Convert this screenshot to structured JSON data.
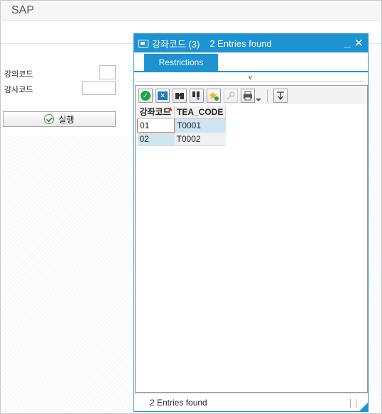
{
  "app": {
    "title": "SAP"
  },
  "form": {
    "fields": [
      {
        "label": "강의코드",
        "value": ""
      },
      {
        "label": "강사코드",
        "value": ""
      }
    ],
    "execute_label": "실행"
  },
  "dialog": {
    "title": "강좌코드 (3)",
    "entries_found": "2 Entries found",
    "minimize_glyph": "_",
    "close_glyph": "✕",
    "tab_label": "Restrictions",
    "collapse_glyph": "v",
    "toolbar": [
      "checkmark-icon",
      "cancel-icon",
      "find-icon",
      "find-next-icon",
      "add-favorite-icon",
      "key-icon",
      "print-icon",
      "sum-icon"
    ],
    "columns": [
      "강좌코드",
      "TEA_CODE"
    ],
    "rows": [
      [
        "01",
        "T0001"
      ],
      [
        "02",
        "T0002"
      ]
    ],
    "status_text": "2 Entries found"
  },
  "colors": {
    "accent": "#1d93d1",
    "selected_cell_border": "#d9733a"
  }
}
